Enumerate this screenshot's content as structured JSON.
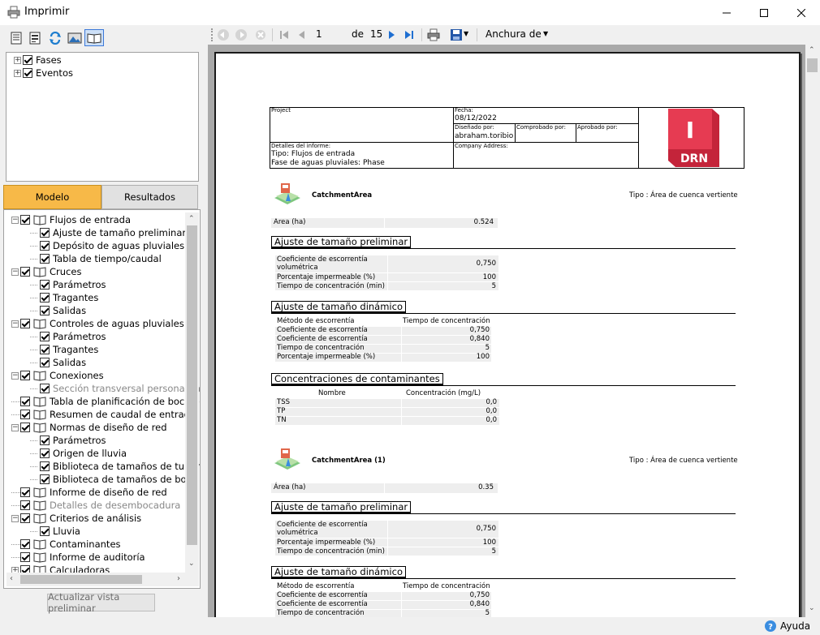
{
  "window": {
    "title": "Imprimir",
    "minimize_icon": "minimize-icon",
    "maximize_icon": "maximize-icon",
    "close_icon": "close-icon"
  },
  "fases_tree": [
    {
      "label": "Fases",
      "checked": true
    },
    {
      "label": "Eventos",
      "checked": true
    }
  ],
  "tabs": {
    "modelo": "Modelo",
    "resultados": "Resultados"
  },
  "model_tree": [
    {
      "label": "Flujos de entrada",
      "level": 0,
      "expander": "−",
      "book": true,
      "checked": true
    },
    {
      "label": "Ajuste de tamaño preliminar",
      "level": 1,
      "checked": true
    },
    {
      "label": "Depósito de aguas pluviales",
      "level": 1,
      "checked": true
    },
    {
      "label": "Tabla de tiempo/caudal",
      "level": 1,
      "checked": true
    },
    {
      "label": "Cruces",
      "level": 0,
      "expander": "−",
      "book": true,
      "checked": true
    },
    {
      "label": "Parámetros",
      "level": 1,
      "checked": true
    },
    {
      "label": "Tragantes",
      "level": 1,
      "checked": true
    },
    {
      "label": "Salidas",
      "level": 1,
      "checked": true
    },
    {
      "label": "Controles de aguas pluviales",
      "level": 0,
      "expander": "−",
      "book": true,
      "checked": true
    },
    {
      "label": "Parámetros",
      "level": 1,
      "checked": true
    },
    {
      "label": "Tragantes",
      "level": 1,
      "checked": true
    },
    {
      "label": "Salidas",
      "level": 1,
      "checked": true
    },
    {
      "label": "Conexiones",
      "level": 0,
      "expander": "−",
      "book": true,
      "checked": true
    },
    {
      "label": "Sección transversal personaliza",
      "level": 1,
      "checked": true,
      "disabled": true
    },
    {
      "label": "Tabla de planificación de boca de",
      "level": 0,
      "book": true,
      "checked": true
    },
    {
      "label": "Resumen de caudal de entrada",
      "level": 0,
      "book": true,
      "checked": true
    },
    {
      "label": "Normas de diseño de red",
      "level": 0,
      "expander": "−",
      "book": true,
      "checked": true
    },
    {
      "label": "Parámetros",
      "level": 1,
      "checked": true
    },
    {
      "label": "Origen de lluvia",
      "level": 1,
      "checked": true
    },
    {
      "label": "Biblioteca de tamaños de tubería",
      "level": 1,
      "checked": true
    },
    {
      "label": "Biblioteca de tamaños de boca d",
      "level": 1,
      "checked": true
    },
    {
      "label": "Informe de diseño de red",
      "level": 0,
      "book": true,
      "checked": true
    },
    {
      "label": "Detalles de desembocadura",
      "level": 0,
      "book": true,
      "checked": true,
      "disabled": true
    },
    {
      "label": "Criterios de análisis",
      "level": 0,
      "expander": "−",
      "book": true,
      "checked": true
    },
    {
      "label": "Lluvia",
      "level": 1,
      "checked": true
    },
    {
      "label": "Contaminantes",
      "level": 0,
      "book": true,
      "checked": true
    },
    {
      "label": "Informe de auditoría",
      "level": 0,
      "book": true,
      "checked": true
    },
    {
      "label": "Calculadoras",
      "level": 0,
      "expander": "+",
      "book": true,
      "checked": true
    }
  ],
  "update_button": "Actualizar vista preliminar",
  "toolbar": {
    "page": "1",
    "of_label": "de",
    "total_pages": "15",
    "zoom": "Anchura de"
  },
  "report": {
    "header": {
      "project_label": "Project",
      "date_label": "Fecha:",
      "date_value": "08/12/2022",
      "designed_label": "Diseñado por:",
      "designed_value": "abraham.toribio",
      "checked_label": "Comprobado por:",
      "approved_label": "Aprobado por:",
      "details_label": "Detalles del informe:",
      "detail1": "Tipo: Flujos de entrada",
      "detail2": "Fase de aguas pluviales: Phase",
      "company_label": "Company Address:",
      "logo_letter": "I",
      "logo_text": "DRN"
    },
    "blocks": [
      {
        "title": "CatchmentArea",
        "type": "Tipo : Área de cuenca vertiente",
        "area_label": "Area (ha)",
        "area_value": "0.524",
        "prelim_title": "Ajuste de tamaño preliminar",
        "prelim_rows": [
          {
            "k1": "Coeficiente de escorrentía",
            "k2": "volumétrica",
            "v": "0,750"
          },
          {
            "k1": "Porcentaje impermeable (%)",
            "v": "100"
          },
          {
            "k1": "Tiempo de concentración (min)",
            "v": "5"
          }
        ],
        "dyn_title": "Ajuste de tamaño dinámico",
        "dyn_rows": [
          {
            "k": "Método de escorrentía",
            "v": "Tiempo de concentración"
          },
          {
            "k": "Coeficiente de escorrentía",
            "v": "0,750"
          },
          {
            "k": "Coeficiente de escorrentía",
            "v": "0,840"
          },
          {
            "k": "Tiempo de concentración",
            "v": "5"
          },
          {
            "k": "Porcentaje impermeable (%)",
            "v": "100"
          }
        ],
        "pollutant_title": "Concentraciones de contaminantes",
        "pollutant_headers": [
          "Nombre",
          "Concentración (mg/L)"
        ],
        "pollutant_rows": [
          {
            "k": "TSS",
            "v": "0,0"
          },
          {
            "k": "TP",
            "v": "0,0"
          },
          {
            "k": "TN",
            "v": "0,0"
          }
        ]
      },
      {
        "title": "CatchmentArea (1)",
        "type": "Tipo : Área de cuenca vertiente",
        "area_label": "Área (ha)",
        "area_value": "0.35",
        "prelim_title": "Ajuste de tamaño preliminar",
        "prelim_rows": [
          {
            "k1": "Coeficiente de escorrentía",
            "k2": "volumétrica",
            "v": "0,750"
          },
          {
            "k1": "Porcentaje impermeable (%)",
            "v": "100"
          },
          {
            "k1": "Tiempo de concentración (min)",
            "v": "5"
          }
        ],
        "dyn_title": "Ajuste de tamaño dinámico",
        "dyn_rows": [
          {
            "k": "Método de escorrentía",
            "v": "Tiempo de concentración"
          },
          {
            "k": "Coeficiente de escorrentía",
            "v": "0,750"
          },
          {
            "k": "Coeficiente de escorrentía",
            "v": "0,840"
          },
          {
            "k": "Tiempo de concentración",
            "v": "5"
          }
        ]
      }
    ]
  },
  "status": {
    "help": "Ayuda"
  },
  "colors": {
    "accent_tab": "#f7b948",
    "logo": "#c4243a",
    "selected_icon_border": "#3b78d8"
  }
}
